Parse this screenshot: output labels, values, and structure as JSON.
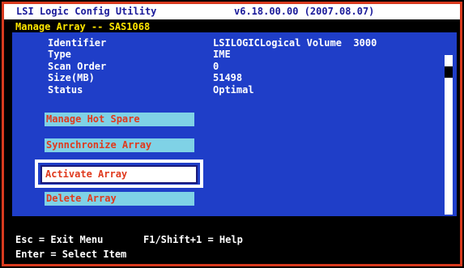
{
  "titlebar": {
    "app_title": "LSI Logic Config Utility",
    "version": "v6.18.00.00 (2007.08.07)"
  },
  "subtitle": "Manage Array -- SAS1068",
  "properties": [
    {
      "label": "Identifier",
      "value": "LSILOGICLogical Volume  3000"
    },
    {
      "label": "Type",
      "value": "IME"
    },
    {
      "label": "Scan Order",
      "value": "0"
    },
    {
      "label": "Size(MB)",
      "value": "51498"
    },
    {
      "label": "Status",
      "value": "Optimal"
    }
  ],
  "menu": {
    "manage_hot_spare": "Manage Hot Spare",
    "synchronize_array": "Synnchronize Array",
    "activate_array": "Activate Array",
    "delete_array": "Delete Array",
    "selected": "Activate Array"
  },
  "footer": {
    "esc": "Esc = Exit Menu",
    "f1": "F1/Shift+1 = Help",
    "enter": "Enter = Select Item"
  },
  "colors": {
    "frame_border": "#d83a1e",
    "panel_bg": "#1f3ec8",
    "menu_button_bg": "#7fd2e6",
    "menu_text": "#e03a1e",
    "subtitle_text": "#ffe600",
    "title_text": "#1a1a9a"
  }
}
